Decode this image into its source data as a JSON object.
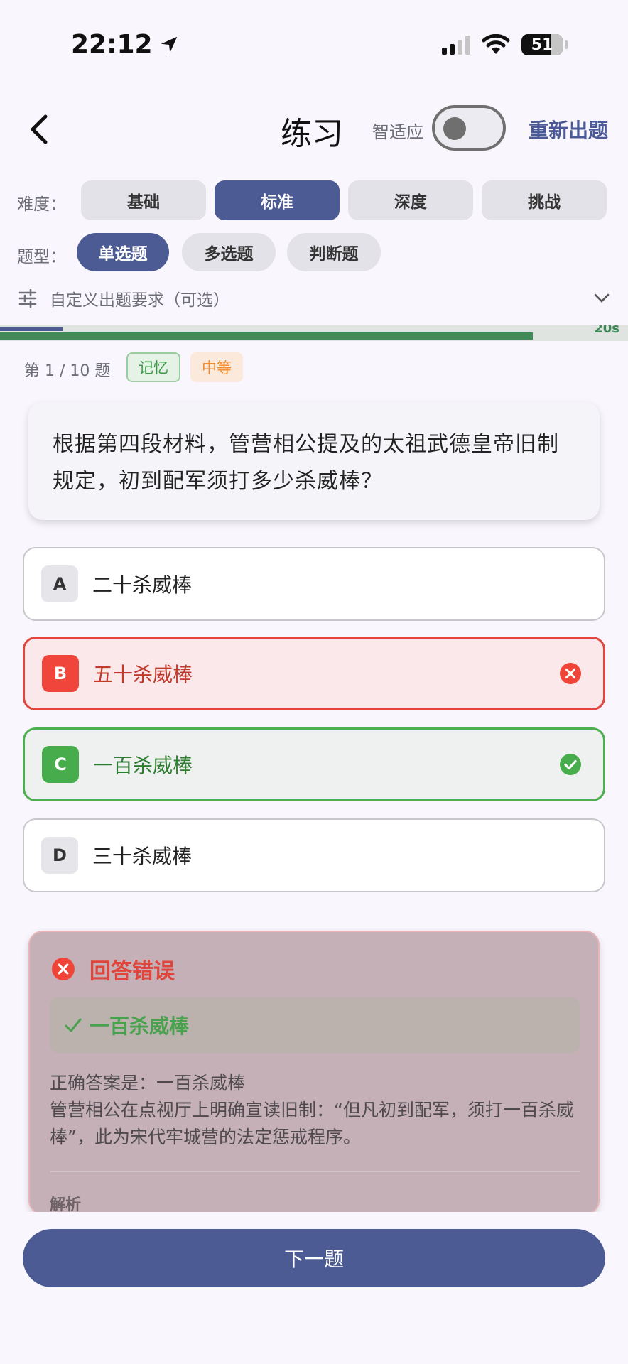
{
  "status_bar": {
    "time": "22:12",
    "battery": "51"
  },
  "nav": {
    "title": "练习",
    "adaptive_label": "智适应",
    "regen_label": "重新出题",
    "adaptive_on": false
  },
  "difficulty": {
    "label": "难度：",
    "options": [
      "基础",
      "标准",
      "深度",
      "挑战"
    ],
    "selected": "标准"
  },
  "question_type": {
    "label": "题型：",
    "options": [
      "单选题",
      "多选题",
      "判断题"
    ],
    "selected": "单选题"
  },
  "custom": {
    "label": "自定义出题要求（可选）"
  },
  "progress": {
    "timer": "20s"
  },
  "question": {
    "counter": "第 1 / 10 题",
    "tags": [
      "记忆",
      "中等"
    ],
    "text": "根据第四段材料，管营相公提及的太祖武德皇帝旧制规定，初到配军须打多少杀威棒？"
  },
  "options": [
    {
      "letter": "A",
      "text": "二十杀威棒",
      "state": "normal"
    },
    {
      "letter": "B",
      "text": "五十杀威棒",
      "state": "wrong"
    },
    {
      "letter": "C",
      "text": "一百杀威棒",
      "state": "correct"
    },
    {
      "letter": "D",
      "text": "三十杀威棒",
      "state": "normal"
    }
  ],
  "feedback": {
    "title": "回答错误",
    "correct_answer": "一百杀威棒",
    "line1": "正确答案是：一百杀威棒",
    "line2": "管营相公在点视厅上明确宣读旧制：“但凡初到配军，须打一百杀威棒”，此为宋代牢城营的法定惩戒程序。",
    "analysis_label": "解析"
  },
  "next_button": "下一题",
  "colors": {
    "accent": "#4d5b94",
    "wrong": "#e2473d",
    "correct": "#4caf50"
  }
}
